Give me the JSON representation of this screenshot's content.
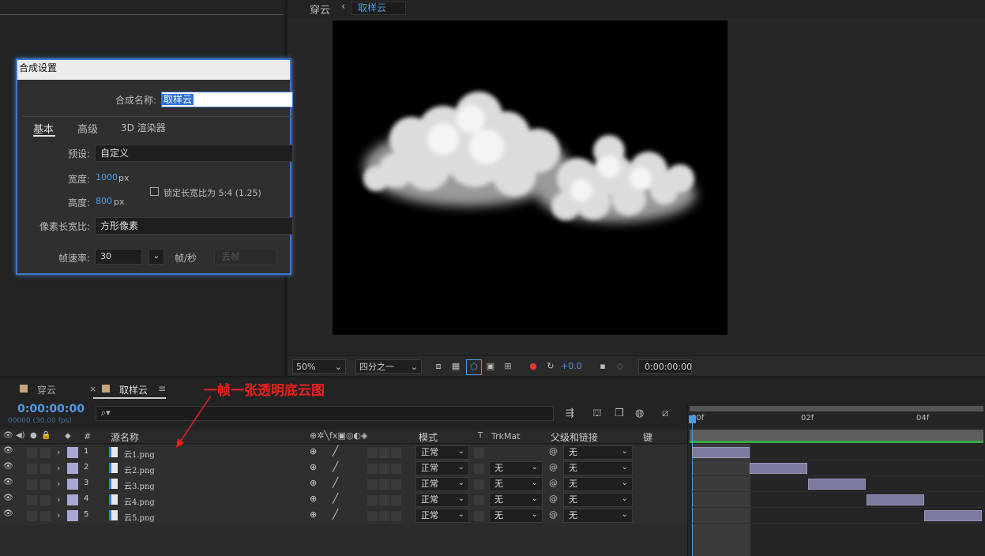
{
  "viewer": {
    "breadcrumb_parent": "穿云",
    "breadcrumb_sep": "‹",
    "breadcrumb_current": "取样云",
    "toolbar": {
      "zoom": "50%",
      "resolution": "四分之一",
      "exposure": "+0.0",
      "timecode": "0:00:00:00"
    }
  },
  "dialog": {
    "title": "合成设置",
    "name_label": "合成名称:",
    "name_value": "取样云",
    "tabs": [
      "基本",
      "高级",
      "3D 渲染器"
    ],
    "preset_label": "预设:",
    "preset_value": "自定义",
    "width_label": "宽度:",
    "width_value": "1000",
    "width_unit": "px",
    "height_label": "高度:",
    "height_value": "800",
    "height_unit": "px",
    "lock_label": "锁定长宽比为 5:4 (1.25)",
    "par_label": "像素长宽比:",
    "par_value": "方形像素",
    "fps_label": "帧速率:",
    "fps_value": "30",
    "fps_unit": "帧/秒",
    "drop_frame": "丢帧"
  },
  "timeline": {
    "tabs": [
      {
        "label": "穿云"
      },
      {
        "label": "取样云"
      }
    ],
    "close_glyph": "×",
    "menu_glyph": "≡",
    "timecode": "0:00:00:00",
    "fps_sub": "00000 (30.00 fps)",
    "search_placeholder": "",
    "columns": {
      "num": "#",
      "source_name": "源名称",
      "mode": "模式",
      "t": "T",
      "trkmat": "TrkMat",
      "parent": "父级和链接",
      "keys": "键"
    },
    "ruler": [
      "00f",
      "02f",
      "04f"
    ],
    "layers": [
      {
        "num": "1",
        "name": "云1.png",
        "mode": "正常",
        "trkmat": "",
        "parent": "无"
      },
      {
        "num": "2",
        "name": "云2.png",
        "mode": "正常",
        "trkmat": "无",
        "parent": "无"
      },
      {
        "num": "3",
        "name": "云3.png",
        "mode": "正常",
        "trkmat": "无",
        "parent": "无"
      },
      {
        "num": "4",
        "name": "云4.png",
        "mode": "正常",
        "trkmat": "无",
        "parent": "无"
      },
      {
        "num": "5",
        "name": "云5.png",
        "mode": "正常",
        "trkmat": "无",
        "parent": "无"
      }
    ]
  },
  "annotation": "一帧一张透明底云图",
  "colors": {
    "accent_blue": "#4a9be8",
    "layer_label": "#a9a8d4",
    "bar": "#7c7a9e",
    "annotation_red": "#e62020"
  }
}
